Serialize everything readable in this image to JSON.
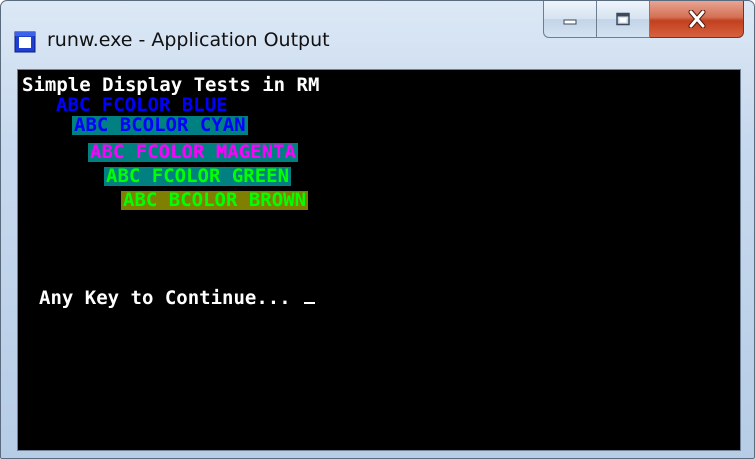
{
  "window": {
    "title": "runw.exe - Application Output",
    "accent_color": "#2b4bd8",
    "close_color": "#c7462a"
  },
  "controls": {
    "minimize": "minimize-icon",
    "maximize": "maximize-icon",
    "close": "close-icon"
  },
  "console": {
    "background": "#000000",
    "lines": [
      {
        "text": "Simple Display Tests in RM",
        "fg": "#ffffff",
        "bg": ""
      },
      {
        "text": "ABC FCOLOR BLUE",
        "fg": "#0000ff",
        "bg": ""
      },
      {
        "text": "ABC BCOLOR CYAN",
        "fg": "#0000ff",
        "bg": "#008080"
      },
      {
        "text": "ABC FCOLOR MAGENTA",
        "fg": "#ff00ff",
        "bg": "#008080"
      },
      {
        "text": "ABC FCOLOR GREEN",
        "fg": "#00ff00",
        "bg": "#008080"
      },
      {
        "text": "ABC BCOLOR BROWN",
        "fg": "#00ff00",
        "bg": "#808000"
      }
    ],
    "prompt": "Any Key to Continue... "
  }
}
